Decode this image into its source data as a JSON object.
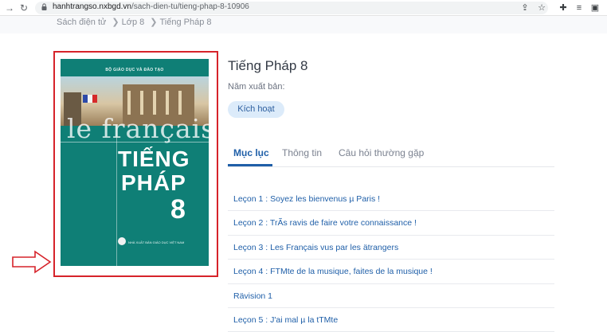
{
  "browser": {
    "url_domain": "hanhtrangso.nxbgd.vn",
    "url_path": "/sach-dien-tu/tieng-phap-8-10906",
    "back_icon": "arrow-right-icon",
    "reload_icon": "reload-icon"
  },
  "breadcrumb": {
    "items": [
      "Sách điện tử",
      "Lớp 8",
      "Tiếng Pháp 8"
    ],
    "separator": "❯"
  },
  "cover": {
    "publisher": "BỘ GIÁO DỤC VÀ ĐÀO TẠO",
    "word": "le français",
    "title_line1": "TIẾNG",
    "title_line2": "PHÁP",
    "number": "8",
    "imprint": "NHÀ XUẤT BẢN GIÁO DỤC VIỆT NAM"
  },
  "book": {
    "title": "Tiếng Pháp 8",
    "publish_label": "Năm xuất bản:",
    "activate_label": "Kích hoạt"
  },
  "tabs": [
    {
      "label": "Mục lục",
      "active": true
    },
    {
      "label": "Thông tin",
      "active": false
    },
    {
      "label": "Câu hỏi thường gặp",
      "active": false
    }
  ],
  "lessons": [
    "Leçon 1 :  Soyez les bienvenus µ Paris !",
    "Leçon 2 :  TrÃs ravis de faire votre connaissance !",
    "Leçon 3 :  Les Français vus par les ätrangers",
    "Leçon 4 :  FTMte de la musique, faites de la musique !",
    "Rävision 1",
    "Leçon 5 :  J'ai mal µ la tTMte"
  ],
  "colors": {
    "cover_teal": "#0f7f76",
    "highlight_red": "#d6232a",
    "link_blue": "#1f5fa8"
  }
}
